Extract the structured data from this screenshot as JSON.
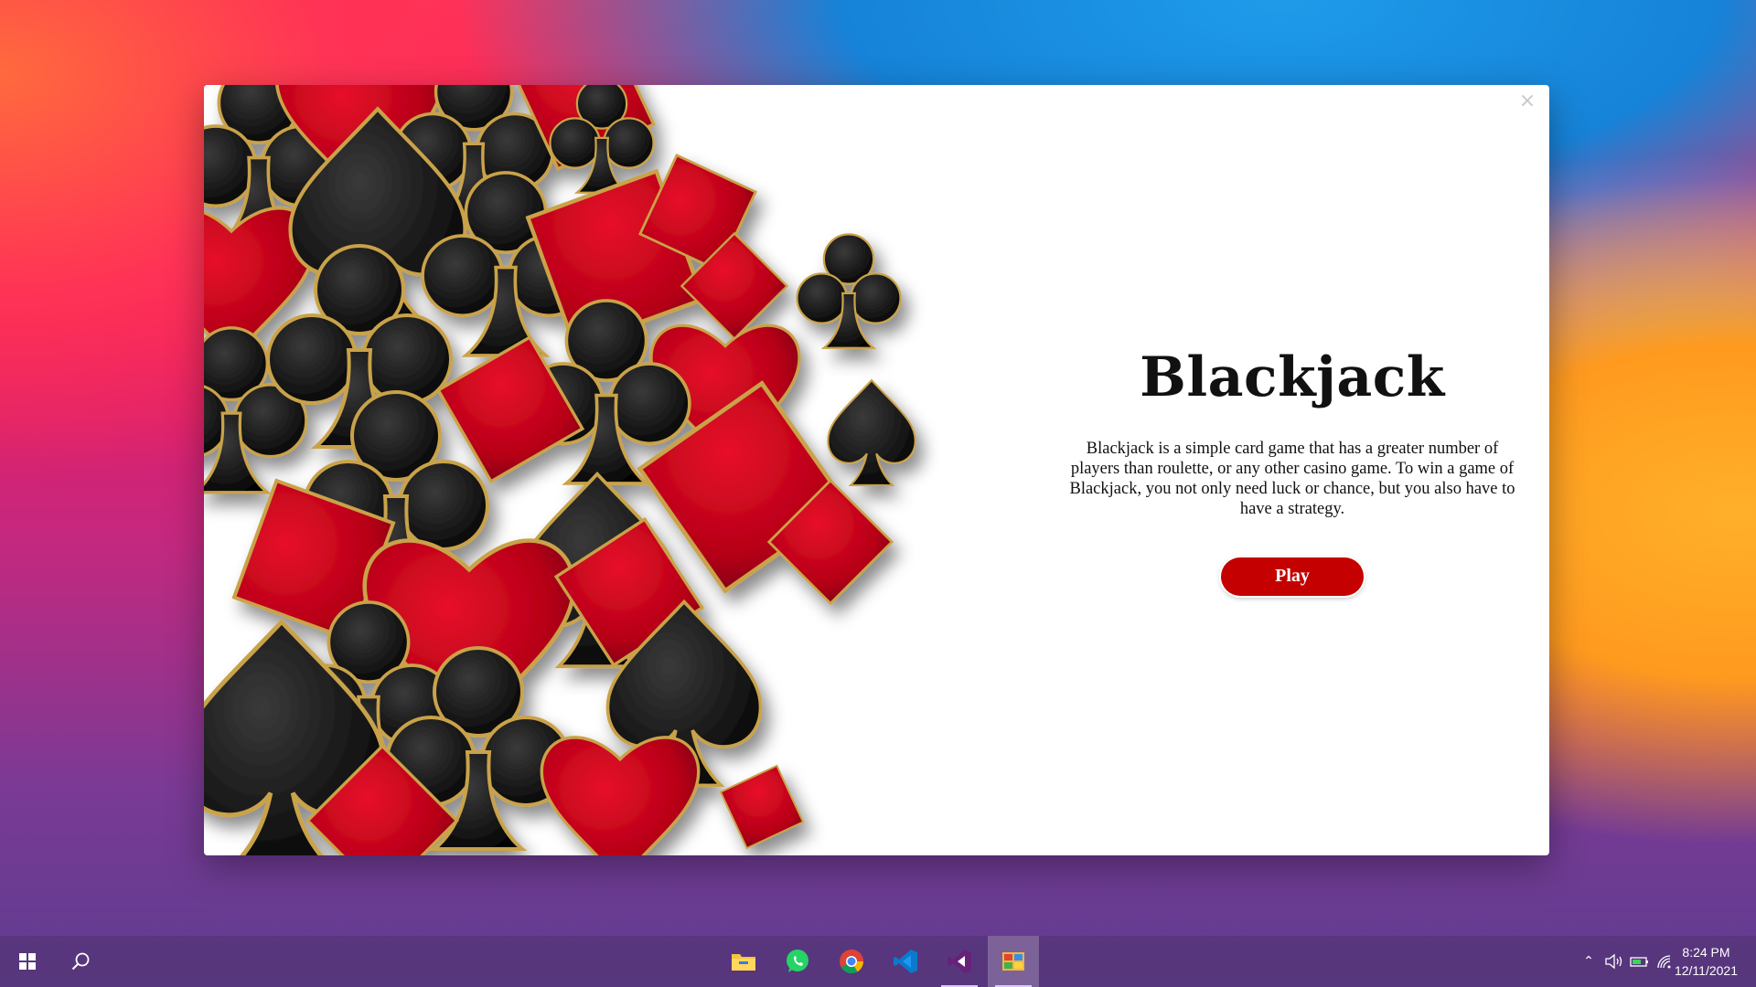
{
  "window": {
    "title": "Blackjack",
    "description": "Blackjack is a simple card game that has a greater number of players than roulette, or any other casino game. To win a game of Blackjack, you not only need luck or chance, but you also have to have a strategy.",
    "play_label": "Play",
    "close_icon": "×"
  },
  "taskbar": {
    "apps": [
      {
        "name": "file-explorer-icon",
        "running": false
      },
      {
        "name": "whatsapp-icon",
        "running": false
      },
      {
        "name": "chrome-icon",
        "running": false
      },
      {
        "name": "vscode-icon",
        "running": false
      },
      {
        "name": "visual-studio-icon",
        "running": true
      },
      {
        "name": "blackjack-app-icon",
        "running": true,
        "active": true
      }
    ],
    "clock": {
      "time": "8:24 PM",
      "date": "12/11/2021"
    }
  },
  "colors": {
    "accent_red": "#c40000",
    "suit_red": "#c8001a",
    "suit_black": "#1b1b1b",
    "gold_outline": "#c9a24a"
  }
}
